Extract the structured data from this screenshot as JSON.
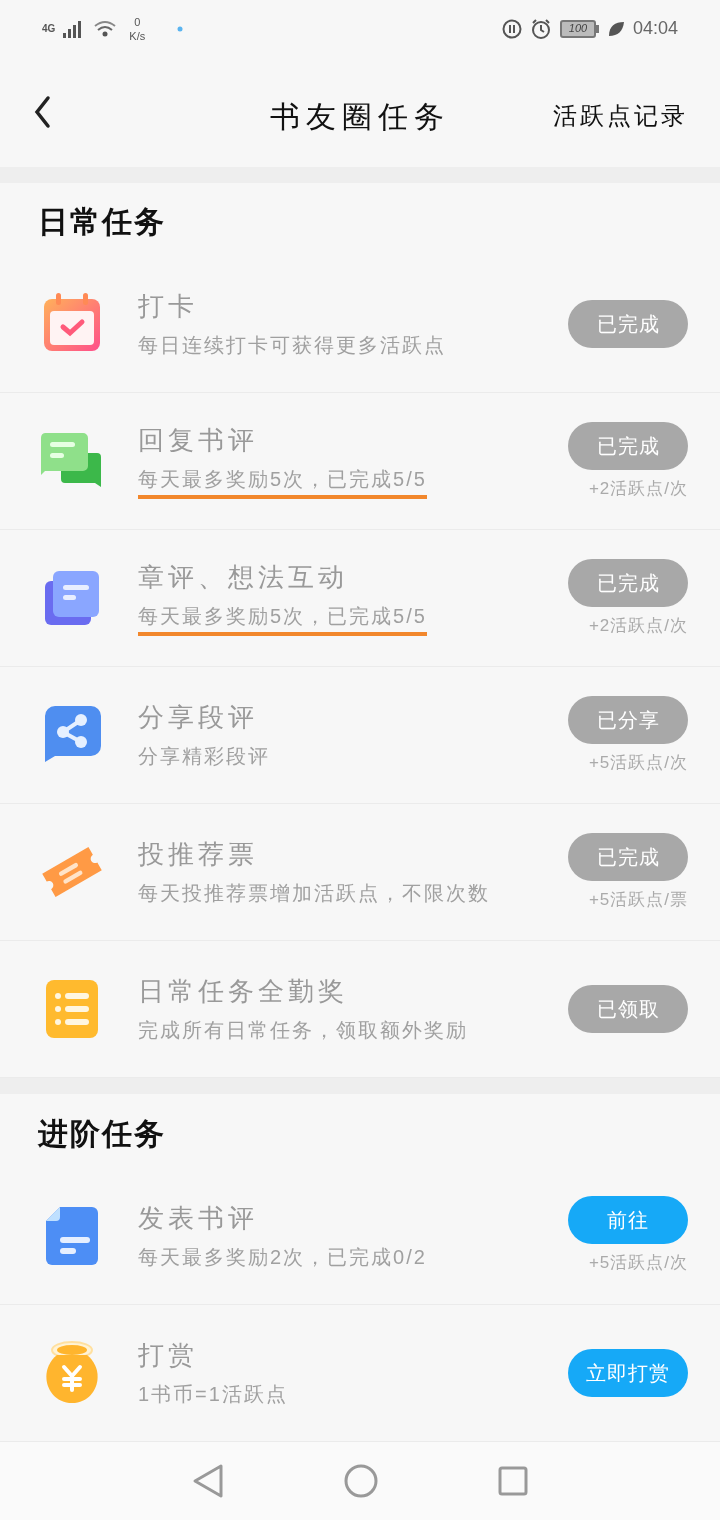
{
  "status_bar": {
    "network": "4G",
    "speed_value": "0",
    "speed_unit": "K/s",
    "battery": "100",
    "time": "04:04"
  },
  "header": {
    "title": "书友圈任务",
    "action": "活跃点记录"
  },
  "sections": [
    {
      "title": "日常任务",
      "tasks": [
        {
          "kind": "calendar",
          "title": "打卡",
          "description": "每日连续打卡可获得更多活跃点",
          "underlined": false,
          "button": {
            "label": "已完成",
            "kind": "done"
          }
        },
        {
          "kind": "chat",
          "title": "回复书评",
          "description": "每天最多奖励5次，已完成5/5",
          "underlined": true,
          "button": {
            "label": "已完成",
            "kind": "done"
          },
          "reward": "+2活跃点/次"
        },
        {
          "kind": "pages",
          "title": "章评、想法互动",
          "description": "每天最多奖励5次，已完成5/5",
          "underlined": true,
          "button": {
            "label": "已完成",
            "kind": "done"
          },
          "reward": "+2活跃点/次"
        },
        {
          "kind": "share",
          "title": "分享段评",
          "description": "分享精彩段评",
          "underlined": false,
          "button": {
            "label": "已分享",
            "kind": "done"
          },
          "reward": "+5活跃点/次"
        },
        {
          "kind": "ticket",
          "title": "投推荐票",
          "description": "每天投推荐票增加活跃点，不限次数",
          "underlined": false,
          "button": {
            "label": "已完成",
            "kind": "done"
          },
          "reward": "+5活跃点/票"
        },
        {
          "kind": "list",
          "title": "日常任务全勤奖",
          "description": "完成所有日常任务，领取额外奖励",
          "underlined": false,
          "button": {
            "label": "已领取",
            "kind": "done"
          }
        }
      ]
    },
    {
      "title": "进阶任务",
      "tasks": [
        {
          "kind": "document",
          "title": "发表书评",
          "description": "每天最多奖励2次，已完成0/2",
          "underlined": false,
          "button": {
            "label": "前往",
            "kind": "action"
          },
          "reward": "+5活跃点/次"
        },
        {
          "kind": "moneybag",
          "title": "打赏",
          "description": "1书币=1活跃点",
          "underlined": false,
          "button": {
            "label": "立即打赏",
            "kind": "action"
          }
        }
      ]
    }
  ]
}
